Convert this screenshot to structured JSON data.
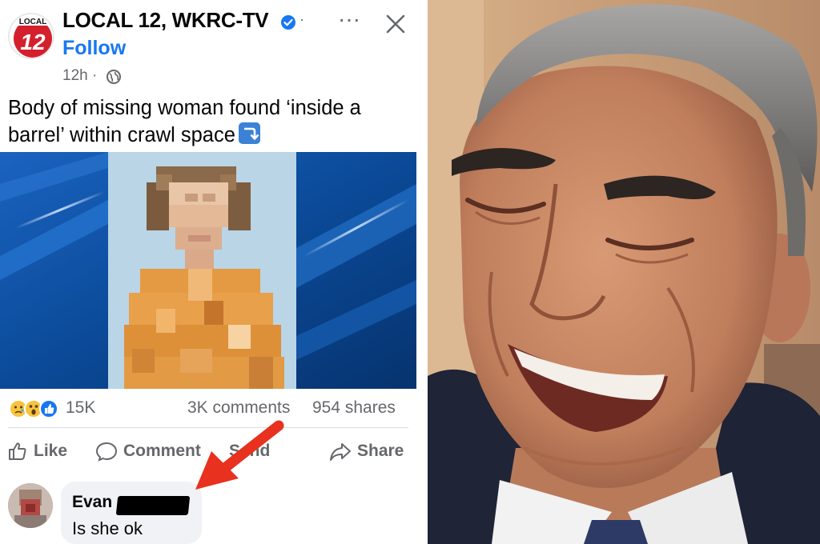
{
  "post": {
    "page_name": "LOCAL 12, WKRC-TV",
    "logo_text_top": "LOCAL",
    "logo_text_number": "12",
    "follow_label": "Follow",
    "timestamp": "12h",
    "separator": "·",
    "more_label": "···",
    "text": "Body of missing woman found ‘inside a barrel’ within crawl space",
    "image_icon": "blurred-portrait",
    "reactions": {
      "icons": [
        "sad-reaction-icon",
        "wow-reaction-icon",
        "like-reaction-icon"
      ],
      "count": "15K"
    },
    "comments_count": "3K comments",
    "shares_count": "954 shares",
    "actions": {
      "like_label": "Like",
      "comment_label": "Comment",
      "send_label": "Send",
      "share_label": "Share"
    }
  },
  "comment": {
    "author": "Evan",
    "text": "Is she ok"
  },
  "annotation": {
    "arrow_color": "#e8311f"
  },
  "colors": {
    "facebook_blue": "#1877f2",
    "secondary_text": "#65676b",
    "logo_red": "#d4202c"
  }
}
